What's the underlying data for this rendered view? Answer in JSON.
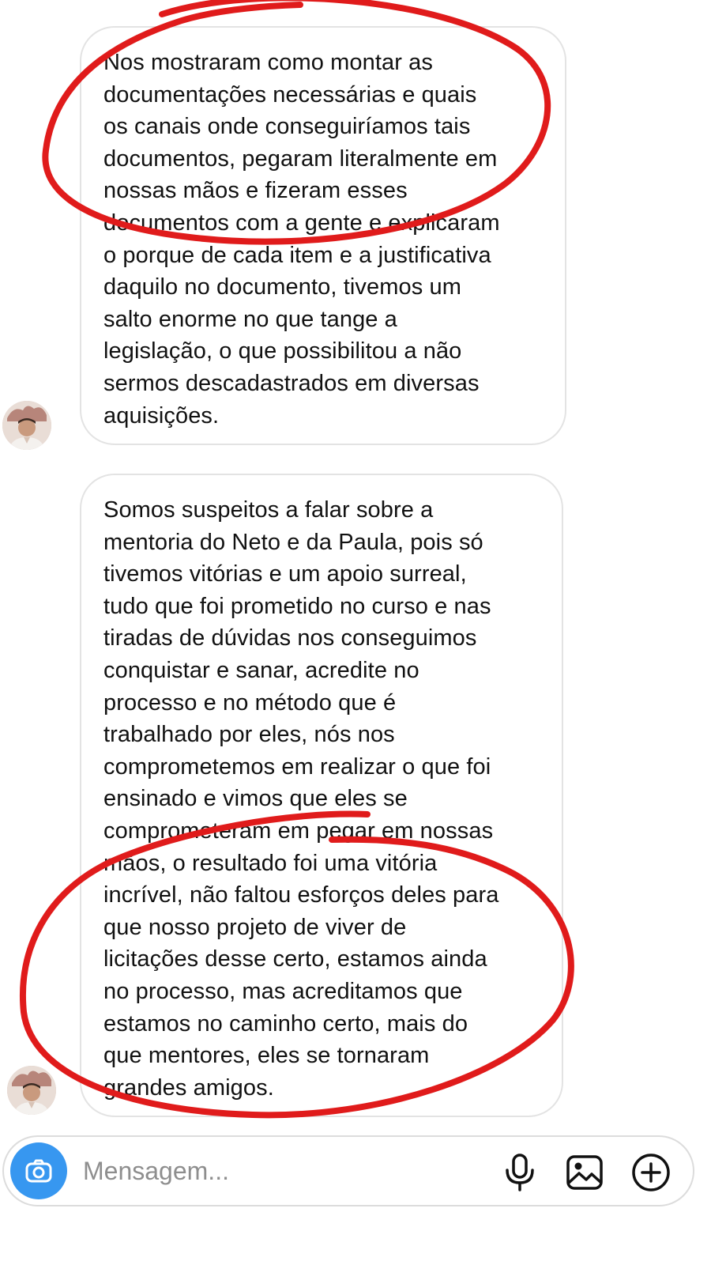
{
  "messages": [
    {
      "text": "Nos mostraram como montar as\ndocumentações necessárias e quais\nos canais onde conseguiríamos tais\ndocumentos, pegaram literalmente em\nnossas mãos e fizeram esses\ndocumentos com a gente e explicaram\no porque de cada item e a justificativa\ndaquilo no documento, tivemos um\nsalto enorme no que tange a\nlegislação, o que possibilitou a não\nsermos descadastrados em diversas\naquisições."
    },
    {
      "text": "Somos suspeitos a falar sobre a\nmentoria do Neto e da Paula, pois só\ntivemos vitórias e um apoio surreal,\ntudo que foi prometido no curso e nas\ntiradas de dúvidas nos conseguimos\nconquistar e sanar, acredite no\nprocesso e no método que é\ntrabalhado por eles, nós nos\ncomprometemos em realizar o que foi\nensinado e vimos que eles se\ncomprometeram em pegar em nossas\nmãos, o resultado foi uma vitória\nincrível, não faltou esforços deles para\nque nosso projeto de viver de\nlicitações desse certo, estamos ainda\nno processo, mas acreditamos que\nestamos no caminho certo, mais do\nque mentores, eles se tornaram\ngrandes amigos."
    }
  ],
  "composer": {
    "placeholder": "Mensagem...",
    "camera_icon": "camera-icon",
    "mic_icon": "microphone-icon",
    "gallery_icon": "image-gallery-icon",
    "add_icon": "add-circle-icon"
  },
  "colors": {
    "annotation_red": "#e01b1b",
    "camera_blue": "#3797f0",
    "bubble_border": "#e3e3e3"
  }
}
